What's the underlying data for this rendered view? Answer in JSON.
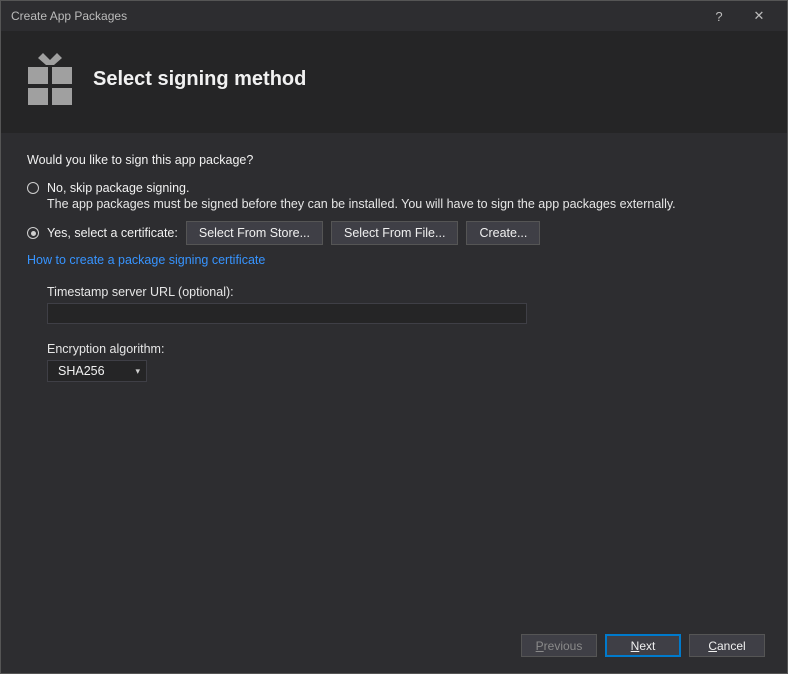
{
  "window": {
    "title": "Create App Packages",
    "help": "?",
    "close": "✕"
  },
  "header": {
    "title": "Select signing method"
  },
  "main": {
    "prompt": "Would you like to sign this app package?",
    "radio_no": "No, skip package signing.",
    "explain_no": "The app packages must be signed before they can be installed. You will have to sign the app packages externally.",
    "radio_yes": "Yes, select a certificate:",
    "btn_store": "Select From Store...",
    "btn_file": "Select From File...",
    "btn_create": "Create...",
    "link_help": "How to create a package signing certificate",
    "timestamp_label": "Timestamp server URL (optional):",
    "timestamp_value": "",
    "encryption_label": "Encryption algorithm:",
    "encryption_value": "SHA256"
  },
  "footer": {
    "previous": "Previous",
    "next": "Next",
    "cancel": "Cancel"
  }
}
